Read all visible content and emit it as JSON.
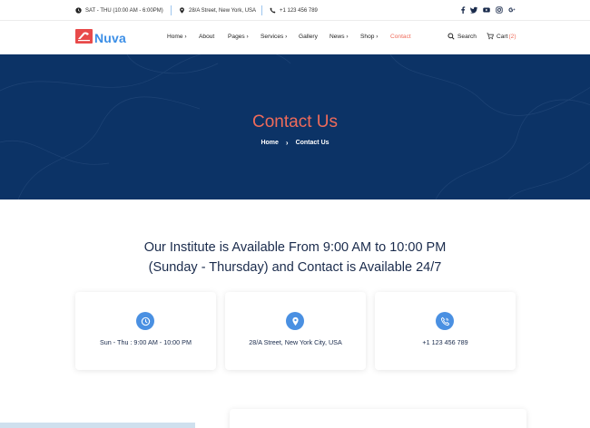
{
  "topbar": {
    "hours": "SAT - THU (10:00 AM - 6:00PM)",
    "address": "28/A Street, New York, USA",
    "phone": "+1 123 456 789",
    "social": [
      "facebook-icon",
      "twitter-icon",
      "youtube-icon",
      "instagram-icon",
      "google-plus-icon"
    ]
  },
  "header": {
    "logo_text": "Nuva",
    "nav": [
      "Home",
      "About",
      "Pages",
      "Services",
      "Gallery",
      "News",
      "Shop",
      "Contact"
    ],
    "active": "Contact",
    "search_label": "Search",
    "cart_label": "Cart",
    "cart_count": "(2)"
  },
  "hero": {
    "title": "Contact Us",
    "breadcrumb": [
      "Home",
      "Contact Us"
    ]
  },
  "main": {
    "heading_line1": "Our Institute is Available From 9:00 AM to 10:00 PM",
    "heading_line2": "(Sunday - Thursday) and Contact is Available 24/7"
  },
  "cards": [
    {
      "icon": "clock-icon",
      "text": "Sun - Thu : 9:00 AM - 10:00 PM"
    },
    {
      "icon": "map-pin-icon",
      "text": "28/A Street, New York City, USA"
    },
    {
      "icon": "phone-icon",
      "text": "+1 123 456 789"
    }
  ],
  "colors": {
    "accent": "#ef6b5a",
    "brand_blue": "#3b8ee6",
    "hero_bg": "#0c3366",
    "icon_bg": "#4a90e2",
    "logo_red": "#e84a4a"
  }
}
